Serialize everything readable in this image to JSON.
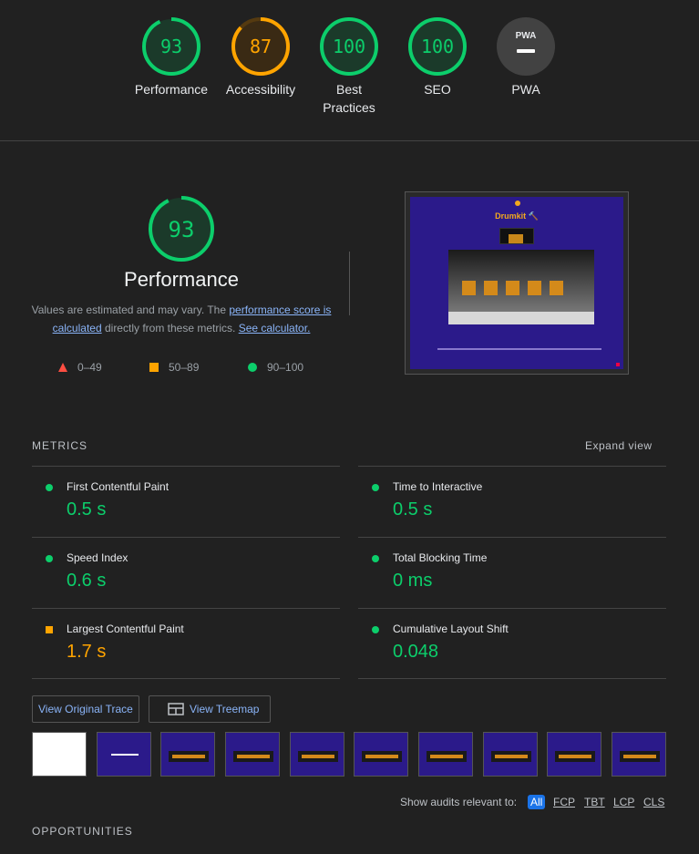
{
  "colors": {
    "pass": "#0cce6b",
    "average": "#ffa400",
    "fail": "#ff4e42"
  },
  "categories": [
    {
      "score": "93",
      "label": "Performance",
      "fraction": 0.93,
      "color": "#0cce6b"
    },
    {
      "score": "87",
      "label": "Accessibility",
      "fraction": 0.87,
      "color": "#ffa400"
    },
    {
      "score": "100",
      "label": "Best\nPractices",
      "fraction": 1.0,
      "color": "#0cce6b"
    },
    {
      "score": "100",
      "label": "SEO",
      "fraction": 1.0,
      "color": "#0cce6b"
    },
    {
      "score": "PWA",
      "label": "PWA",
      "icon": "pwa-icon"
    }
  ],
  "performance": {
    "score": "93",
    "fraction": 0.93,
    "title": "Performance",
    "desc_prefix": "Values are estimated and may vary. The ",
    "link1": "performance score is calculated",
    "desc_mid": " directly from these metrics. ",
    "link2": "See calculator."
  },
  "legend": [
    {
      "shape": "triangle",
      "range": "0–49"
    },
    {
      "shape": "square",
      "range": "50–89"
    },
    {
      "shape": "circle",
      "range": "90–100"
    }
  ],
  "screenshot": {
    "app_title": "Drumkit 🔨"
  },
  "metrics_header": "METRICS",
  "expand_view": "Expand view",
  "metrics": [
    {
      "title": "First Contentful Paint",
      "value": "0.5 s",
      "status": "pass"
    },
    {
      "title": "Time to Interactive",
      "value": "0.5 s",
      "status": "pass"
    },
    {
      "title": "Speed Index",
      "value": "0.6 s",
      "status": "pass"
    },
    {
      "title": "Total Blocking Time",
      "value": "0 ms",
      "status": "pass"
    },
    {
      "title": "Largest Contentful Paint",
      "value": "1.7 s",
      "status": "average"
    },
    {
      "title": "Cumulative Layout Shift",
      "value": "0.048",
      "status": "pass"
    }
  ],
  "buttons": {
    "trace": "View Original Trace",
    "treemap": "View Treemap"
  },
  "filter": {
    "label": "Show audits relevant to:",
    "chips": [
      "All",
      "FCP",
      "TBT",
      "LCP",
      "CLS"
    ]
  },
  "opportunities_header": "OPPORTUNITIES"
}
